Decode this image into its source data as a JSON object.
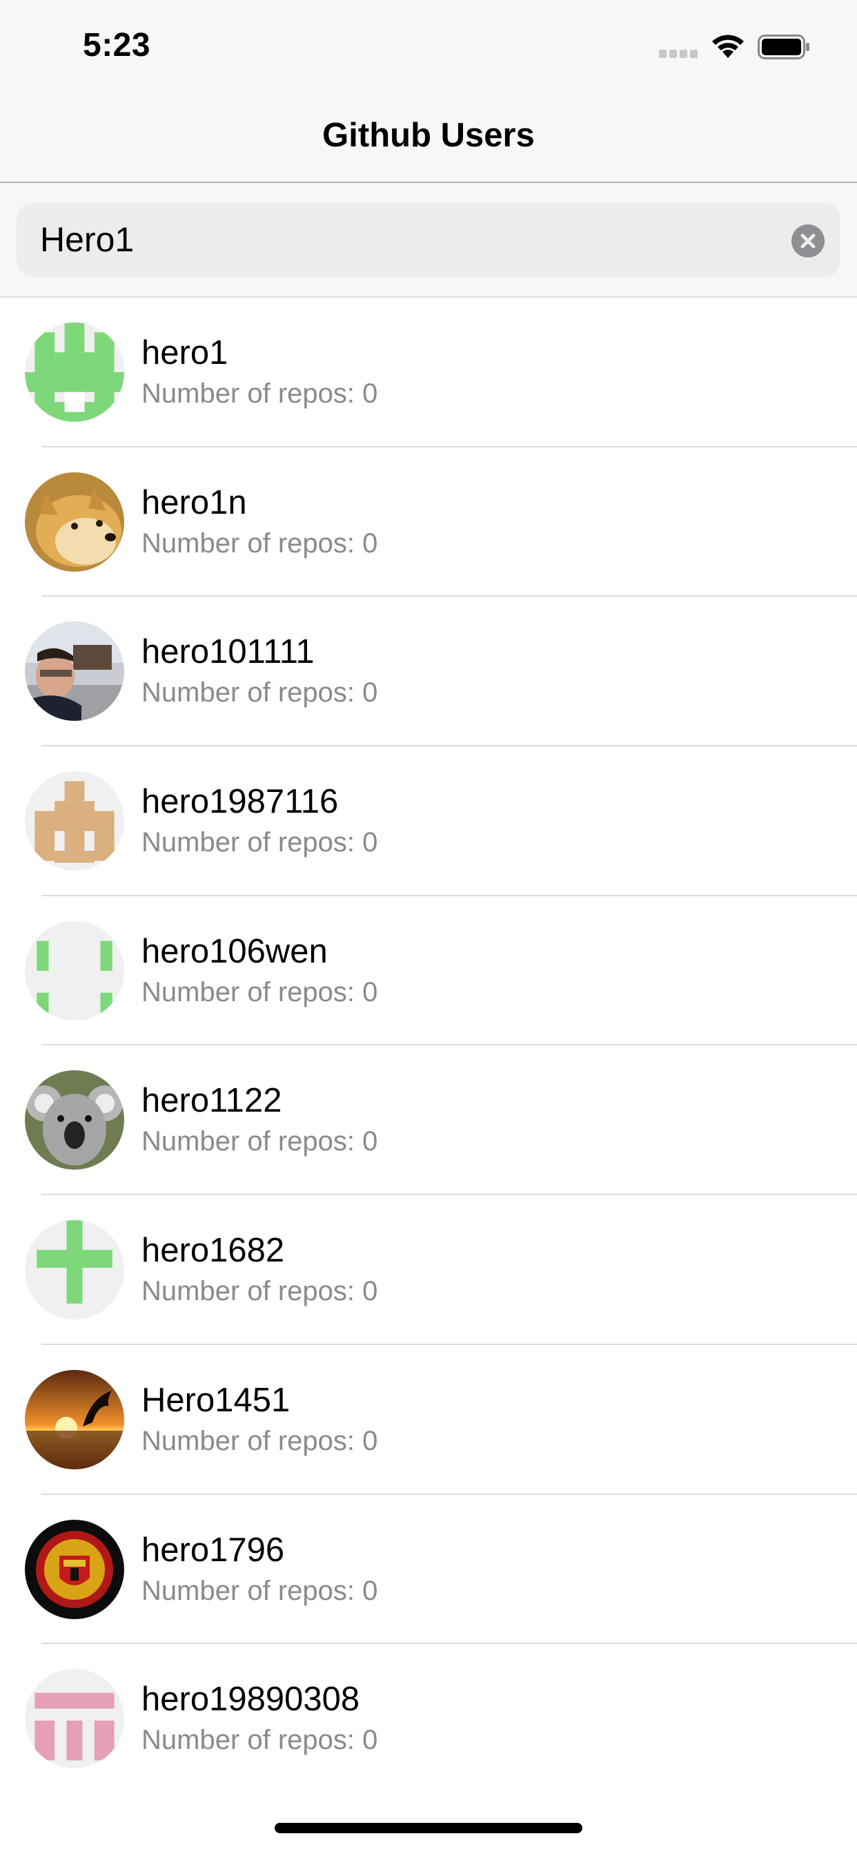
{
  "status_bar": {
    "time": "5:23"
  },
  "nav": {
    "title": "Github Users"
  },
  "search": {
    "value": "Hero1"
  },
  "users": [
    {
      "username": "hero1",
      "repos": "Number of repos: 0"
    },
    {
      "username": "hero1n",
      "repos": "Number of repos: 0"
    },
    {
      "username": "hero101111",
      "repos": "Number of repos: 0"
    },
    {
      "username": "hero1987116",
      "repos": "Number of repos: 0"
    },
    {
      "username": "hero106wen",
      "repos": "Number of repos: 0"
    },
    {
      "username": "hero1122",
      "repos": "Number of repos: 0"
    },
    {
      "username": "hero1682",
      "repos": "Number of repos: 0"
    },
    {
      "username": "Hero1451",
      "repos": "Number of repos: 0"
    },
    {
      "username": "hero1796",
      "repos": "Number of repos: 0"
    },
    {
      "username": "hero19890308",
      "repos": "Number of repos: 0"
    }
  ],
  "colors": {
    "identicon_green": "#7ed87a",
    "identicon_tan": "#d9b07e",
    "identicon_pink": "#e4a0b6",
    "secondary_text": "#8a8a8e"
  }
}
